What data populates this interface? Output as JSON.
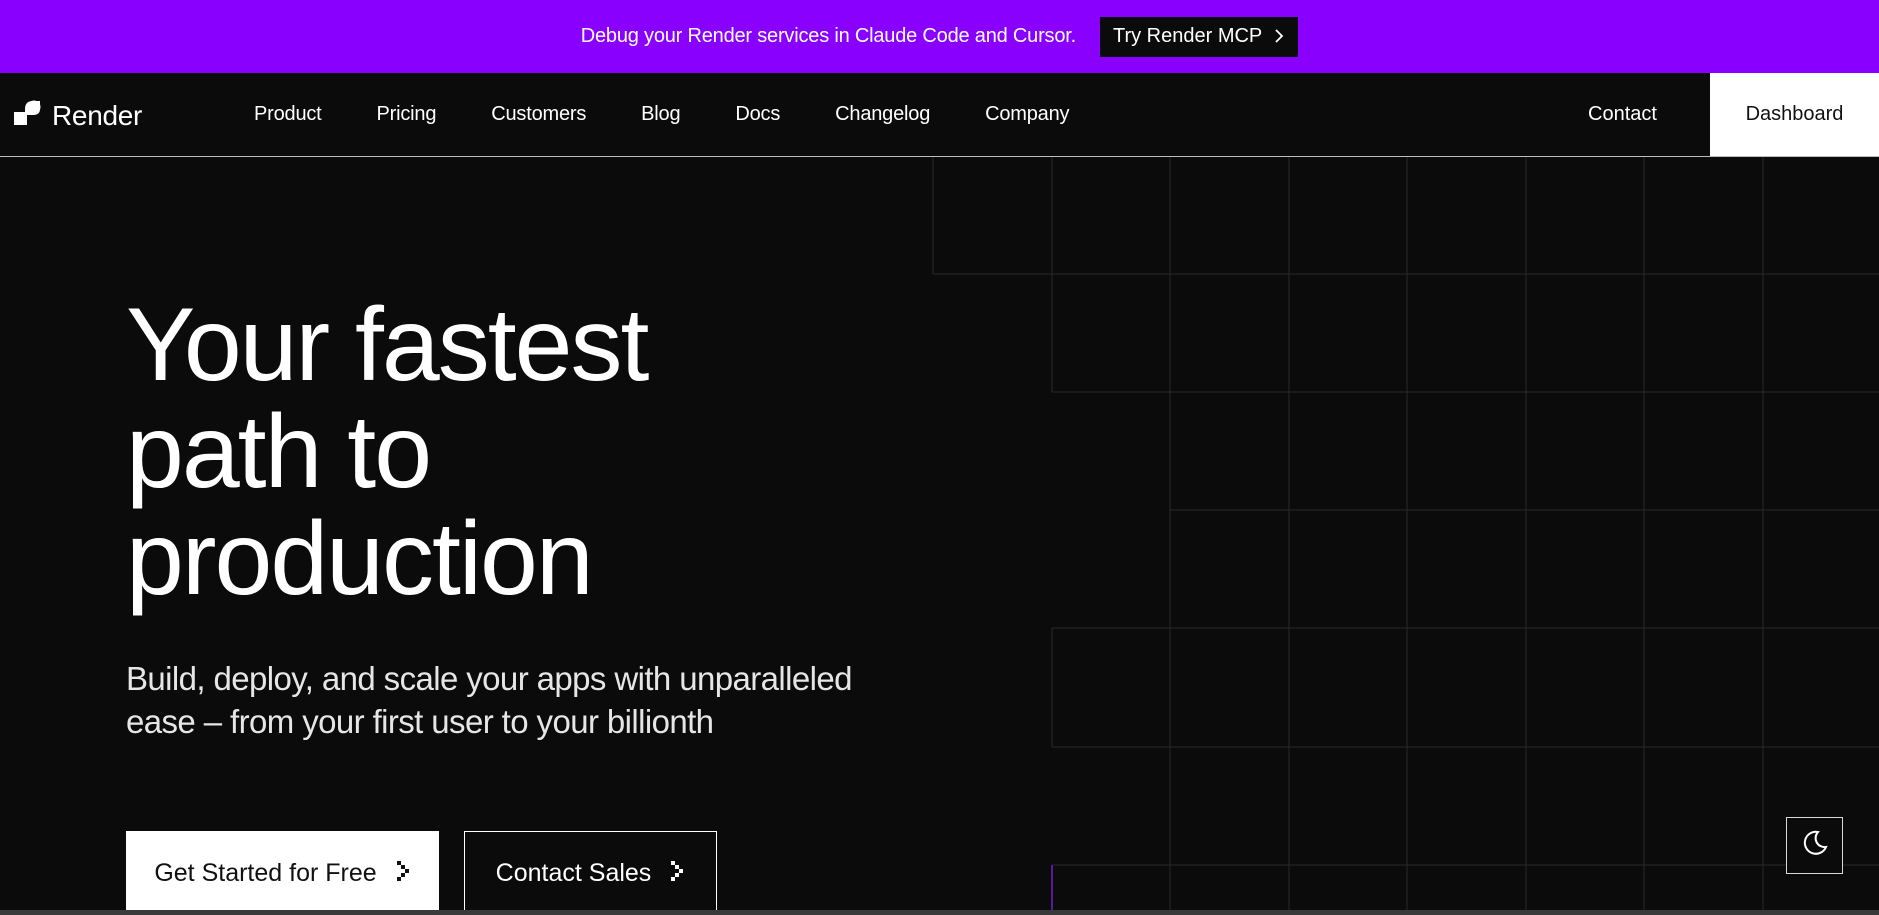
{
  "banner": {
    "text": "Debug your Render services in Claude Code and Cursor.",
    "button_label": "Try Render MCP",
    "button_icon": "chevron-right-icon",
    "background_color": "#8a00ff"
  },
  "nav": {
    "logo_text": "Render",
    "logo_icon": "render-logo-icon",
    "links": [
      "Product",
      "Pricing",
      "Customers",
      "Blog",
      "Docs",
      "Changelog",
      "Company"
    ],
    "contact_label": "Contact",
    "dashboard_label": "Dashboard"
  },
  "hero": {
    "title_lines": [
      "Your fastest",
      "path to",
      "production"
    ],
    "subtitle_lines": [
      "Build, deploy, and scale your apps with unparalleled",
      "ease – from your first user to your billionth"
    ],
    "primary_cta": "Get Started for Free",
    "secondary_cta": "Contact Sales",
    "cta_icon": "pixel-arrow-right-icon"
  },
  "theme_toggle": {
    "icon": "moon-icon"
  },
  "colors": {
    "background": "#0b0b0b",
    "grid_line": "#2a2a2a",
    "accent_purple": "#8a00ff"
  }
}
